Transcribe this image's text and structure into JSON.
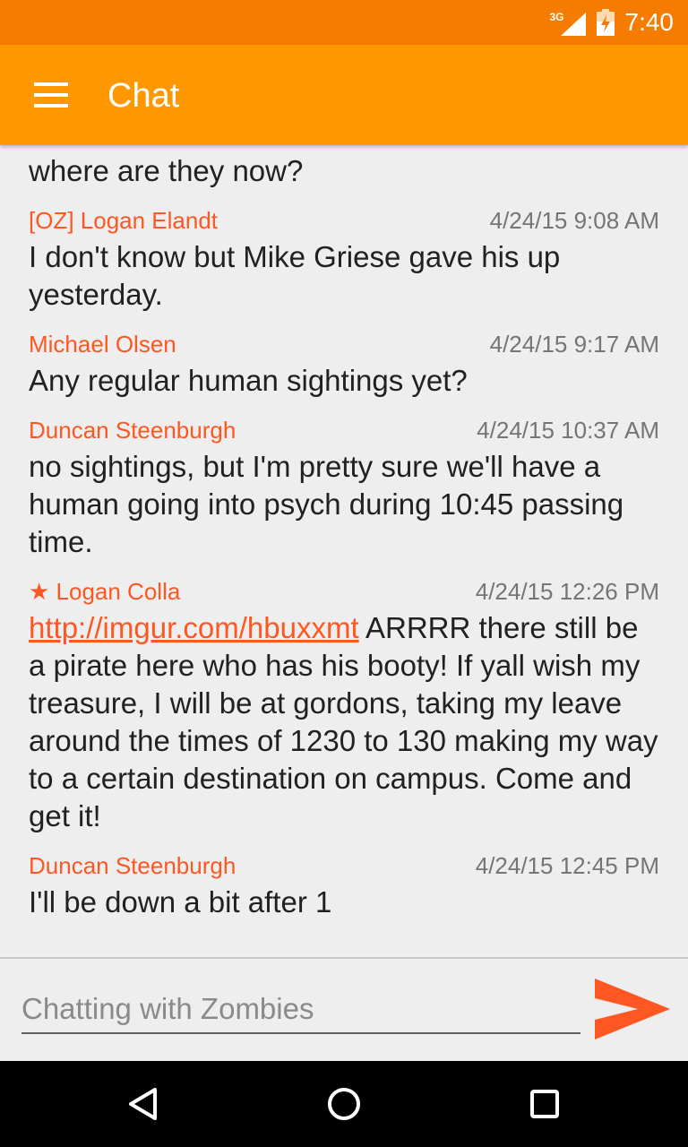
{
  "status_bar": {
    "network": "3G",
    "time": "7:40"
  },
  "app_bar": {
    "title": "Chat"
  },
  "messages": [
    {
      "text": "where are they now?"
    },
    {
      "sender": "[OZ] Logan Elandt",
      "time": "4/24/15 9:08 AM",
      "text": "I don't know but Mike Griese gave his up yesterday."
    },
    {
      "sender": "Michael Olsen",
      "time": "4/24/15 9:17 AM",
      "text": "Any regular human sightings yet?"
    },
    {
      "sender": "Duncan Steenburgh",
      "time": "4/24/15 10:37 AM",
      "text": "no sightings, but I'm pretty sure we'll have a human going into psych during 10:45 passing time."
    },
    {
      "sender": "★ Logan Colla",
      "time": "4/24/15 12:26 PM",
      "link": "http://imgur.com/hbuxxmt",
      "text": " ARRRR there still be a pirate here who has his booty! If yall wish my treasure, I will be at gordons, taking my leave around the times of 1230 to 130 making my way to a certain destination on campus. Come and get it!"
    },
    {
      "sender": "Duncan Steenburgh",
      "time": "4/24/15 12:45 PM",
      "text": "I'll be down a bit after 1"
    }
  ],
  "composer": {
    "placeholder": "Chatting with Zombies",
    "value": ""
  },
  "colors": {
    "status_bar": "#f57c00",
    "app_bar": "#ff9800",
    "accent": "#ff5722"
  },
  "icons": {
    "menu": "hamburger-icon",
    "send": "send-icon",
    "back": "back-triangle-icon",
    "home": "home-circle-icon",
    "recents": "recents-square-icon"
  }
}
